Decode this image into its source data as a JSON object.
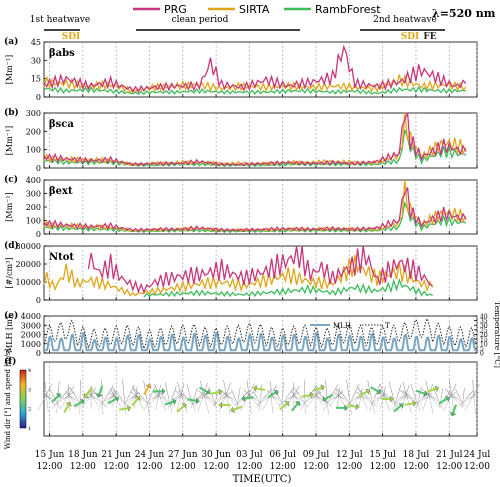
{
  "colors": {
    "PRG": "#c8357a",
    "SIRTA": "#e0a61a",
    "RambForest": "#3cbc5a",
    "MLH": "#7aa6c2",
    "T": "#222222",
    "SDI_mark": "#e0a61a"
  },
  "legend": {
    "prg": "PRG",
    "sirta": "SIRTA",
    "ramb": "RambForest"
  },
  "wavelength": "λ=520 nm",
  "periods": {
    "heatwave1": "1st heatwave",
    "heatwave1_sup": "st",
    "clean": "clean period",
    "heatwave2": "2nd heatwave",
    "heatwave2_sup": "nd",
    "sdi1": "SDI",
    "sdi2": "SDI",
    "fe": "FE"
  },
  "panel_tags": {
    "a": "(a)",
    "b": "(b)",
    "c": "(c)",
    "d": "(d)",
    "e": "(e)",
    "f": "(f)"
  },
  "xaxis": {
    "title": "TIME(UTC)",
    "tick_dates": [
      "15 Jun",
      "18 Jun",
      "21 Jun",
      "24 Jun",
      "27 Jun",
      "30 Jun",
      "03 Jul",
      "06 Jul",
      "09 Jul",
      "12 Jul",
      "15 Jul",
      "18 Jul",
      "21 Jul",
      "24 Jul"
    ],
    "tick_times": [
      "12:00",
      "12:00",
      "12:00",
      "12:00",
      "12:00",
      "12:00",
      "12:00",
      "12:00",
      "12:00",
      "12:00",
      "12:00",
      "12:00",
      "12:00",
      "12:00"
    ]
  },
  "chart_data": [
    {
      "type": "line",
      "panel": "a",
      "label": "βabs",
      "ylabel": "[Mm⁻¹]",
      "ylim": [
        0,
        45
      ],
      "yticks": [
        0,
        15,
        30,
        45
      ],
      "xlim": [
        15,
        54
      ],
      "series": [
        {
          "name": "PRG",
          "x": [
            15,
            17,
            19,
            21,
            23,
            25,
            27,
            29,
            30,
            31,
            33,
            35,
            37,
            39,
            41,
            42,
            43,
            45,
            47,
            49,
            51,
            52,
            53
          ],
          "y": [
            10,
            15,
            9,
            12,
            6,
            8,
            9,
            9,
            28,
            10,
            8,
            14,
            9,
            12,
            16,
            40,
            11,
            9,
            12,
            22,
            13,
            9,
            11
          ]
        },
        {
          "name": "SIRTA",
          "x": [
            15,
            17,
            19,
            21,
            23,
            25,
            27,
            29,
            31,
            33,
            35,
            37,
            39,
            41,
            43,
            45,
            47,
            49,
            51,
            53
          ],
          "y": [
            12,
            11,
            9,
            10,
            5,
            8,
            9,
            10,
            7,
            9,
            8,
            9,
            8,
            9,
            8,
            7,
            14,
            9,
            10,
            8
          ]
        },
        {
          "name": "RambForest",
          "x": [
            15,
            17,
            19,
            21,
            23,
            25,
            27,
            29,
            31,
            33,
            35,
            37,
            39,
            41,
            43,
            45,
            47,
            49,
            51,
            53
          ],
          "y": [
            7,
            5,
            6,
            5,
            3,
            4,
            4,
            5,
            4,
            4,
            4,
            5,
            5,
            4,
            5,
            3,
            6,
            6,
            5,
            5
          ]
        }
      ]
    },
    {
      "type": "line",
      "panel": "b",
      "label": "βsca",
      "ylabel": "[Mm⁻¹]",
      "ylim": [
        0,
        300
      ],
      "yticks": [
        0,
        100,
        200,
        300
      ],
      "xlim": [
        15,
        54
      ],
      "series": [
        {
          "name": "PRG",
          "x": [
            15,
            17,
            19,
            21,
            23,
            25,
            27,
            29,
            31,
            33,
            35,
            37,
            39,
            41,
            43,
            45,
            47,
            47.5,
            48,
            49,
            51,
            53
          ],
          "y": [
            60,
            50,
            40,
            45,
            20,
            25,
            25,
            35,
            20,
            20,
            25,
            30,
            25,
            30,
            25,
            35,
            80,
            330,
            150,
            60,
            120,
            90
          ]
        },
        {
          "name": "SIRTA",
          "x": [
            15,
            17,
            19,
            21,
            23,
            25,
            27,
            29,
            31,
            33,
            35,
            37,
            39,
            41,
            43,
            45,
            47,
            47.5,
            48,
            49,
            51,
            53
          ],
          "y": [
            55,
            45,
            45,
            40,
            20,
            25,
            30,
            30,
            25,
            25,
            25,
            30,
            30,
            35,
            30,
            30,
            70,
            280,
            160,
            60,
            140,
            110
          ]
        },
        {
          "name": "RambForest",
          "x": [
            15,
            17,
            19,
            21,
            23,
            25,
            27,
            29,
            31,
            33,
            35,
            37,
            39,
            41,
            43,
            45,
            47,
            47.5,
            48,
            49,
            51,
            53
          ],
          "y": [
            40,
            30,
            30,
            30,
            15,
            15,
            20,
            20,
            15,
            15,
            15,
            20,
            20,
            20,
            20,
            20,
            40,
            200,
            110,
            40,
            90,
            70
          ]
        }
      ]
    },
    {
      "type": "line",
      "panel": "c",
      "label": "βext",
      "ylabel": "[Mm⁻¹]",
      "ylim": [
        0,
        400
      ],
      "yticks": [
        0,
        100,
        200,
        300,
        400
      ],
      "xlim": [
        15,
        54
      ],
      "series": [
        {
          "name": "PRG",
          "x": [
            15,
            17,
            19,
            21,
            23,
            25,
            27,
            29,
            31,
            33,
            35,
            37,
            39,
            41,
            43,
            45,
            47,
            47.5,
            48,
            49,
            51,
            53
          ],
          "y": [
            80,
            65,
            55,
            60,
            30,
            35,
            35,
            45,
            30,
            30,
            35,
            40,
            35,
            40,
            35,
            45,
            100,
            370,
            170,
            70,
            150,
            110
          ]
        },
        {
          "name": "SIRTA",
          "x": [
            15,
            17,
            19,
            21,
            23,
            25,
            27,
            29,
            31,
            33,
            35,
            37,
            39,
            41,
            43,
            45,
            47,
            47.5,
            48,
            49,
            51,
            53
          ],
          "y": [
            70,
            60,
            55,
            50,
            25,
            30,
            35,
            40,
            30,
            30,
            30,
            35,
            35,
            40,
            35,
            35,
            80,
            300,
            180,
            70,
            160,
            130
          ]
        },
        {
          "name": "RambForest",
          "x": [
            15,
            17,
            19,
            21,
            23,
            25,
            27,
            29,
            31,
            33,
            35,
            37,
            39,
            41,
            43,
            45,
            47,
            47.5,
            48,
            49,
            51,
            53
          ],
          "y": [
            50,
            40,
            35,
            35,
            20,
            20,
            25,
            25,
            20,
            20,
            20,
            25,
            25,
            25,
            25,
            25,
            50,
            220,
            120,
            45,
            100,
            80
          ]
        }
      ]
    },
    {
      "type": "line",
      "panel": "d",
      "label": "Ntot",
      "ylabel": "[#/cm³]",
      "ylim": [
        0,
        30000
      ],
      "yticks": [
        0,
        10000,
        20000,
        30000
      ],
      "xlim": [
        15,
        54
      ],
      "series": [
        {
          "name": "PRG",
          "x": [
            19,
            20,
            21,
            22,
            23,
            24,
            25,
            27,
            29,
            31,
            33,
            35,
            37,
            38,
            39,
            40,
            41,
            43,
            44,
            45,
            47,
            49,
            50
          ],
          "y": [
            24000,
            15000,
            19000,
            12000,
            8000,
            6000,
            10000,
            13000,
            14000,
            17000,
            12000,
            16000,
            22000,
            26000,
            14000,
            18000,
            12000,
            20000,
            25000,
            11000,
            21000,
            14000,
            8000
          ]
        },
        {
          "name": "SIRTA",
          "x": [
            15,
            16,
            17,
            18,
            19,
            21,
            23,
            25,
            27,
            29,
            31,
            33,
            35,
            37,
            39,
            41,
            43,
            45,
            47,
            49,
            50
          ],
          "y": [
            13000,
            7000,
            16000,
            9000,
            11000,
            8000,
            3000,
            5000,
            7000,
            9000,
            10000,
            8000,
            11000,
            14000,
            10000,
            9000,
            20000,
            12000,
            16000,
            9000,
            7000
          ]
        },
        {
          "name": "RambForest",
          "x": [
            24,
            25,
            27,
            29,
            31,
            33,
            35,
            37,
            39,
            41,
            43,
            45,
            47,
            49,
            50
          ],
          "y": [
            2500,
            3000,
            3500,
            4000,
            3500,
            3000,
            4000,
            5000,
            6000,
            4000,
            7000,
            5000,
            9000,
            4000,
            2500
          ]
        }
      ]
    },
    {
      "type": "line",
      "panel": "e",
      "ylabel": "MLH [m]",
      "ylabel_right": "Temperature [°C]",
      "ylim": [
        0,
        4000
      ],
      "yticks": [
        0,
        1000,
        2000,
        3000,
        4000
      ],
      "ylim_right": [
        0,
        40
      ],
      "yticks_right": [
        0,
        5,
        10,
        15,
        20,
        25,
        30,
        35,
        40
      ],
      "xlim": [
        15,
        54
      ],
      "legend": [
        "MLH",
        "T"
      ],
      "series": [
        {
          "name": "MLH",
          "daily_max": [
            1800,
            1600,
            2000,
            2200,
            1400,
            1700,
            1600,
            1900,
            2000,
            1500,
            1800,
            2000,
            1700,
            2100,
            1900,
            2200,
            1800,
            1600,
            2000,
            2100,
            1700,
            1900,
            2000,
            1800,
            2200,
            1600,
            2000,
            1900,
            1800,
            2100,
            1700,
            1600,
            2000,
            1800,
            1700,
            1900,
            1800,
            1500,
            1600
          ]
        },
        {
          "name": "T",
          "daily_max": [
            30,
            33,
            35,
            28,
            26,
            27,
            29,
            30,
            28,
            25,
            27,
            29,
            30,
            31,
            28,
            27,
            29,
            30,
            32,
            31,
            28,
            27,
            29,
            30,
            28,
            27,
            29,
            31,
            30,
            28,
            29,
            30,
            33,
            36,
            37,
            32,
            29,
            28,
            27
          ]
        }
      ]
    },
    {
      "type": "scatter",
      "panel": "f",
      "ylabel": "Wind dir [°] and speed [m/s]",
      "colorbar_ticks": [
        1,
        2,
        3,
        4
      ],
      "xlim": [
        15,
        54
      ],
      "arrows_dir_deg": [
        45,
        30,
        60,
        225,
        200,
        60,
        80,
        40,
        30,
        90,
        70,
        50,
        100,
        120,
        80,
        270,
        250,
        260,
        280,
        60,
        50,
        40,
        80,
        70,
        240,
        90,
        100,
        60,
        120,
        90,
        50,
        80,
        110,
        70,
        60,
        200
      ],
      "arrows_speed": [
        2,
        3,
        2.5,
        3,
        2,
        2,
        3,
        3,
        4,
        2,
        2,
        3,
        2,
        2,
        3,
        3,
        3,
        2,
        3,
        2,
        3,
        2,
        3,
        3,
        2,
        2,
        3,
        3,
        2,
        3,
        2,
        3,
        2,
        3,
        2,
        2
      ]
    }
  ]
}
